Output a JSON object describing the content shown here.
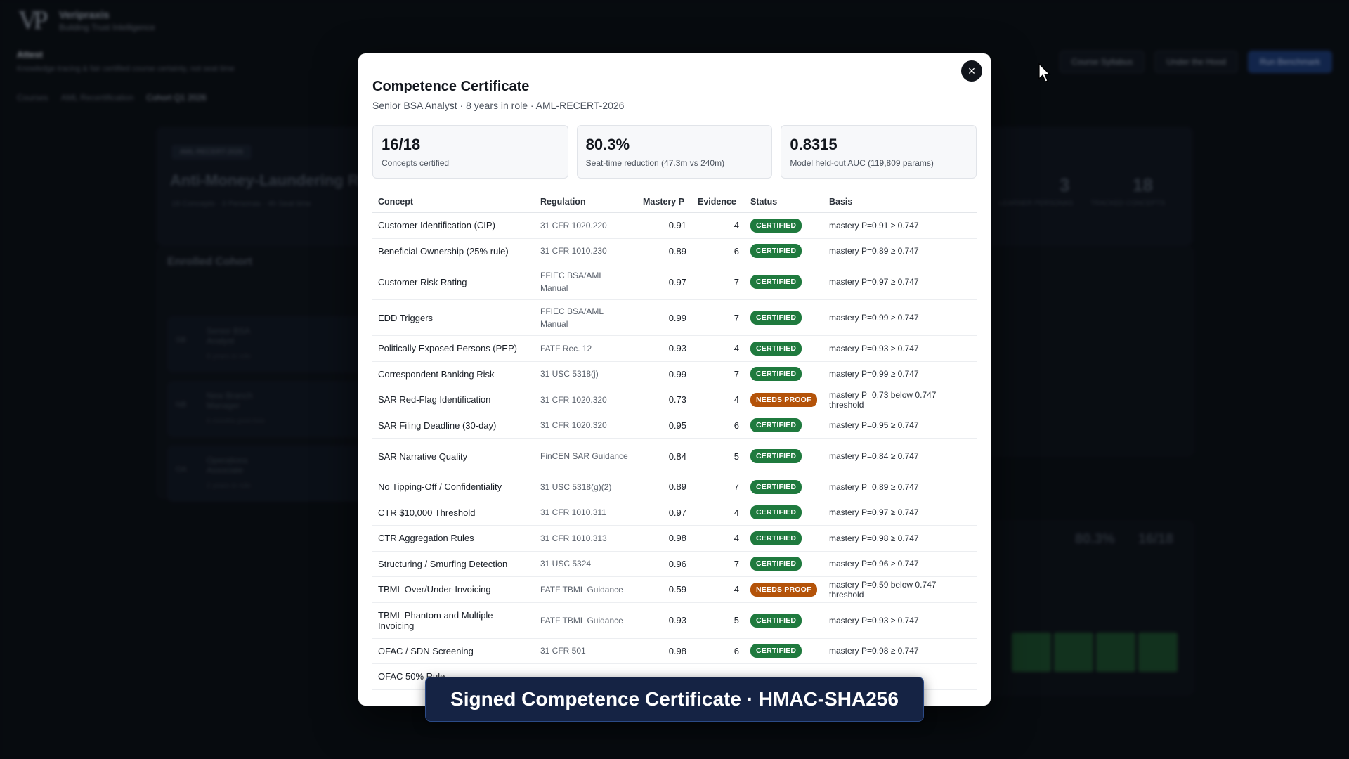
{
  "background": {
    "app_name": "Veripraxis",
    "app_tagline": "Building Trust Intelligence",
    "page_title": "Attest",
    "page_subtitle": "Knowledge tracing & fair certified course certainty, not seat time",
    "breadcrumbs": [
      "Courses",
      "AML Recertification",
      "Cohort Q1 2026"
    ],
    "top_buttons": [
      "Course Syllabus",
      "Under the Hood",
      "Run Benchmark"
    ],
    "course_badge": "AML-RECERT-2026",
    "course_title": "Anti-Money-Laundering R",
    "course_meta": "18 Concepts · 3 Personas · 4h Seat time",
    "stat_a": "3",
    "stat_a_label": "LEARNER PERSONAS",
    "stat_b": "18",
    "stat_b_label": "TRACKED CONCEPTS",
    "cohort_title": "Enrolled Cohort",
    "cohort_members": [
      {
        "initials": "SB",
        "name": "Senior BSA Analyst",
        "meta": "8 years in role"
      },
      {
        "initials": "NB",
        "name": "New Branch Manager",
        "meta": "6 months post-hire"
      },
      {
        "initials": "OA",
        "name": "Operations Associate",
        "meta": "2 years in role"
      }
    ],
    "summary_pct": "80.3%",
    "summary_cert": "16/18"
  },
  "modal": {
    "title": "Competence Certificate",
    "subtitle": "Senior BSA Analyst · 8 years in role · AML-RECERT-2026",
    "close_label": "×",
    "stats": [
      {
        "value": "16/18",
        "label": "Concepts certified"
      },
      {
        "value": "80.3%",
        "label": "Seat-time reduction (47.3m vs 240m)"
      },
      {
        "value": "0.8315",
        "label": "Model held-out AUC (119,809 params)"
      }
    ],
    "columns": {
      "concept": "Concept",
      "regulation": "Regulation",
      "mastery": "Mastery P",
      "evidence": "Evidence",
      "status": "Status",
      "basis": "Basis"
    },
    "rows": [
      {
        "concept": "Customer Identification (CIP)",
        "regulation": "31 CFR 1020.220",
        "mastery": "0.91",
        "evidence": "4",
        "status": "CERTIFIED",
        "basis": "mastery P=0.91 ≥ 0.747"
      },
      {
        "concept": "Beneficial Ownership (25% rule)",
        "regulation": "31 CFR 1010.230",
        "mastery": "0.89",
        "evidence": "6",
        "status": "CERTIFIED",
        "basis": "mastery P=0.89 ≥ 0.747"
      },
      {
        "concept": "Customer Risk Rating",
        "regulation": "FFIEC BSA/AML Manual",
        "mastery": "0.97",
        "evidence": "7",
        "status": "CERTIFIED",
        "basis": "mastery P=0.97 ≥ 0.747"
      },
      {
        "concept": "EDD Triggers",
        "regulation": "FFIEC BSA/AML Manual",
        "mastery": "0.99",
        "evidence": "7",
        "status": "CERTIFIED",
        "basis": "mastery P=0.99 ≥ 0.747"
      },
      {
        "concept": "Politically Exposed Persons (PEP)",
        "regulation": "FATF Rec. 12",
        "mastery": "0.93",
        "evidence": "4",
        "status": "CERTIFIED",
        "basis": "mastery P=0.93 ≥ 0.747"
      },
      {
        "concept": "Correspondent Banking Risk",
        "regulation": "31 USC 5318(j)",
        "mastery": "0.99",
        "evidence": "7",
        "status": "CERTIFIED",
        "basis": "mastery P=0.99 ≥ 0.747"
      },
      {
        "concept": "SAR Red-Flag Identification",
        "regulation": "31 CFR 1020.320",
        "mastery": "0.73",
        "evidence": "4",
        "status": "NEEDS PROOF",
        "basis": "mastery P=0.73 below 0.747 threshold"
      },
      {
        "concept": "SAR Filing Deadline (30-day)",
        "regulation": "31 CFR 1020.320",
        "mastery": "0.95",
        "evidence": "6",
        "status": "CERTIFIED",
        "basis": "mastery P=0.95 ≥ 0.747"
      },
      {
        "concept": "SAR Narrative Quality",
        "regulation": "FinCEN SAR Guidance",
        "mastery": "0.84",
        "evidence": "5",
        "status": "CERTIFIED",
        "basis": "mastery P=0.84 ≥ 0.747"
      },
      {
        "concept": "No Tipping-Off / Confidentiality",
        "regulation": "31 USC 5318(g)(2)",
        "mastery": "0.89",
        "evidence": "7",
        "status": "CERTIFIED",
        "basis": "mastery P=0.89 ≥ 0.747"
      },
      {
        "concept": "CTR $10,000 Threshold",
        "regulation": "31 CFR 1010.311",
        "mastery": "0.97",
        "evidence": "4",
        "status": "CERTIFIED",
        "basis": "mastery P=0.97 ≥ 0.747"
      },
      {
        "concept": "CTR Aggregation Rules",
        "regulation": "31 CFR 1010.313",
        "mastery": "0.98",
        "evidence": "4",
        "status": "CERTIFIED",
        "basis": "mastery P=0.98 ≥ 0.747"
      },
      {
        "concept": "Structuring / Smurfing Detection",
        "regulation": "31 USC 5324",
        "mastery": "0.96",
        "evidence": "7",
        "status": "CERTIFIED",
        "basis": "mastery P=0.96 ≥ 0.747"
      },
      {
        "concept": "TBML Over/Under-Invoicing",
        "regulation": "FATF TBML Guidance",
        "mastery": "0.59",
        "evidence": "4",
        "status": "NEEDS PROOF",
        "basis": "mastery P=0.59 below 0.747 threshold"
      },
      {
        "concept": "TBML Phantom and Multiple Invoicing",
        "regulation": "FATF TBML Guidance",
        "mastery": "0.93",
        "evidence": "5",
        "status": "CERTIFIED",
        "basis": "mastery P=0.93 ≥ 0.747"
      },
      {
        "concept": "OFAC / SDN Screening",
        "regulation": "31 CFR 501",
        "mastery": "0.98",
        "evidence": "6",
        "status": "CERTIFIED",
        "basis": "mastery P=0.98 ≥ 0.747"
      },
      {
        "concept": "OFAC 50% Rule",
        "regulation": "",
        "mastery": "",
        "evidence": "",
        "status": "",
        "basis": ""
      }
    ]
  },
  "caption": "Signed Competence Certificate · HMAC-SHA256",
  "colors": {
    "certified": "#1f7a3e",
    "needs_proof": "#b45309",
    "caption_bg": "#152344"
  }
}
